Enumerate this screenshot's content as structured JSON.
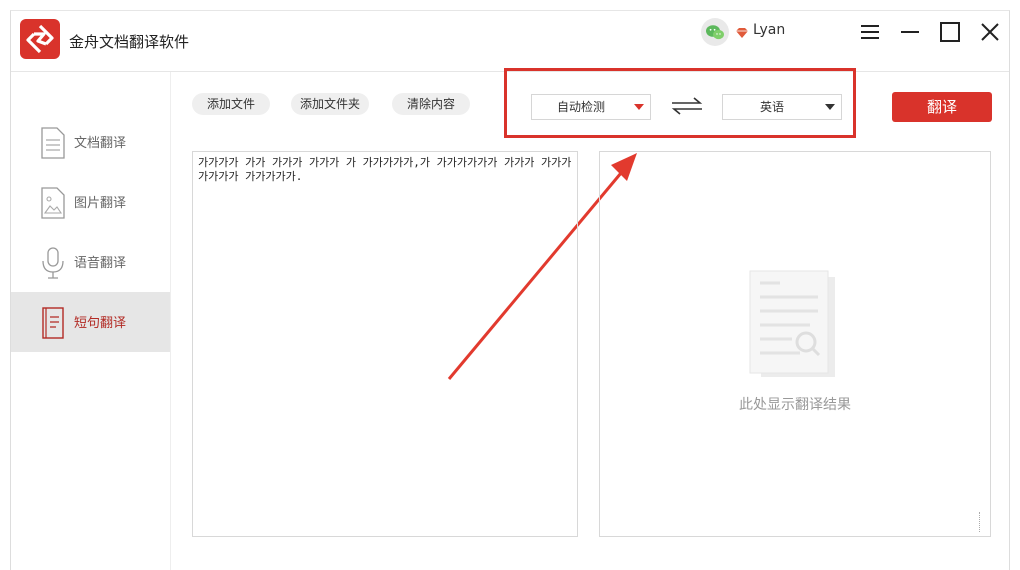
{
  "app": {
    "title": "金舟文档翻译软件",
    "user": "Lyan"
  },
  "titlebar_icons": [
    "wechat-icon",
    "gem-icon",
    "menu-icon",
    "minimize-icon",
    "maximize-icon",
    "close-icon"
  ],
  "sidebar": {
    "items": [
      {
        "label": "文档翻译",
        "icon": "document-icon",
        "active": false
      },
      {
        "label": "图片翻译",
        "icon": "image-icon",
        "active": false
      },
      {
        "label": "语音翻译",
        "icon": "microphone-icon",
        "active": false
      },
      {
        "label": "短句翻译",
        "icon": "short-text-icon",
        "active": true
      }
    ]
  },
  "toolbar": {
    "add_file": "添加文件",
    "add_folder": "添加文件夹",
    "clear_content": "清除内容",
    "translate": "翻译"
  },
  "languages": {
    "source": "自动检测",
    "target": "英语"
  },
  "input": {
    "text": "가가가가 가가 가가가 가가가 가 가가가가가,가 가가가가가가 가가가 가가가 가가가가 가가가가가."
  },
  "output": {
    "placeholder": "此处显示翻译结果"
  },
  "colors": {
    "accent": "#d9332b",
    "active_nav_bg": "#e6e6e6",
    "active_nav_text": "#b22a24"
  }
}
